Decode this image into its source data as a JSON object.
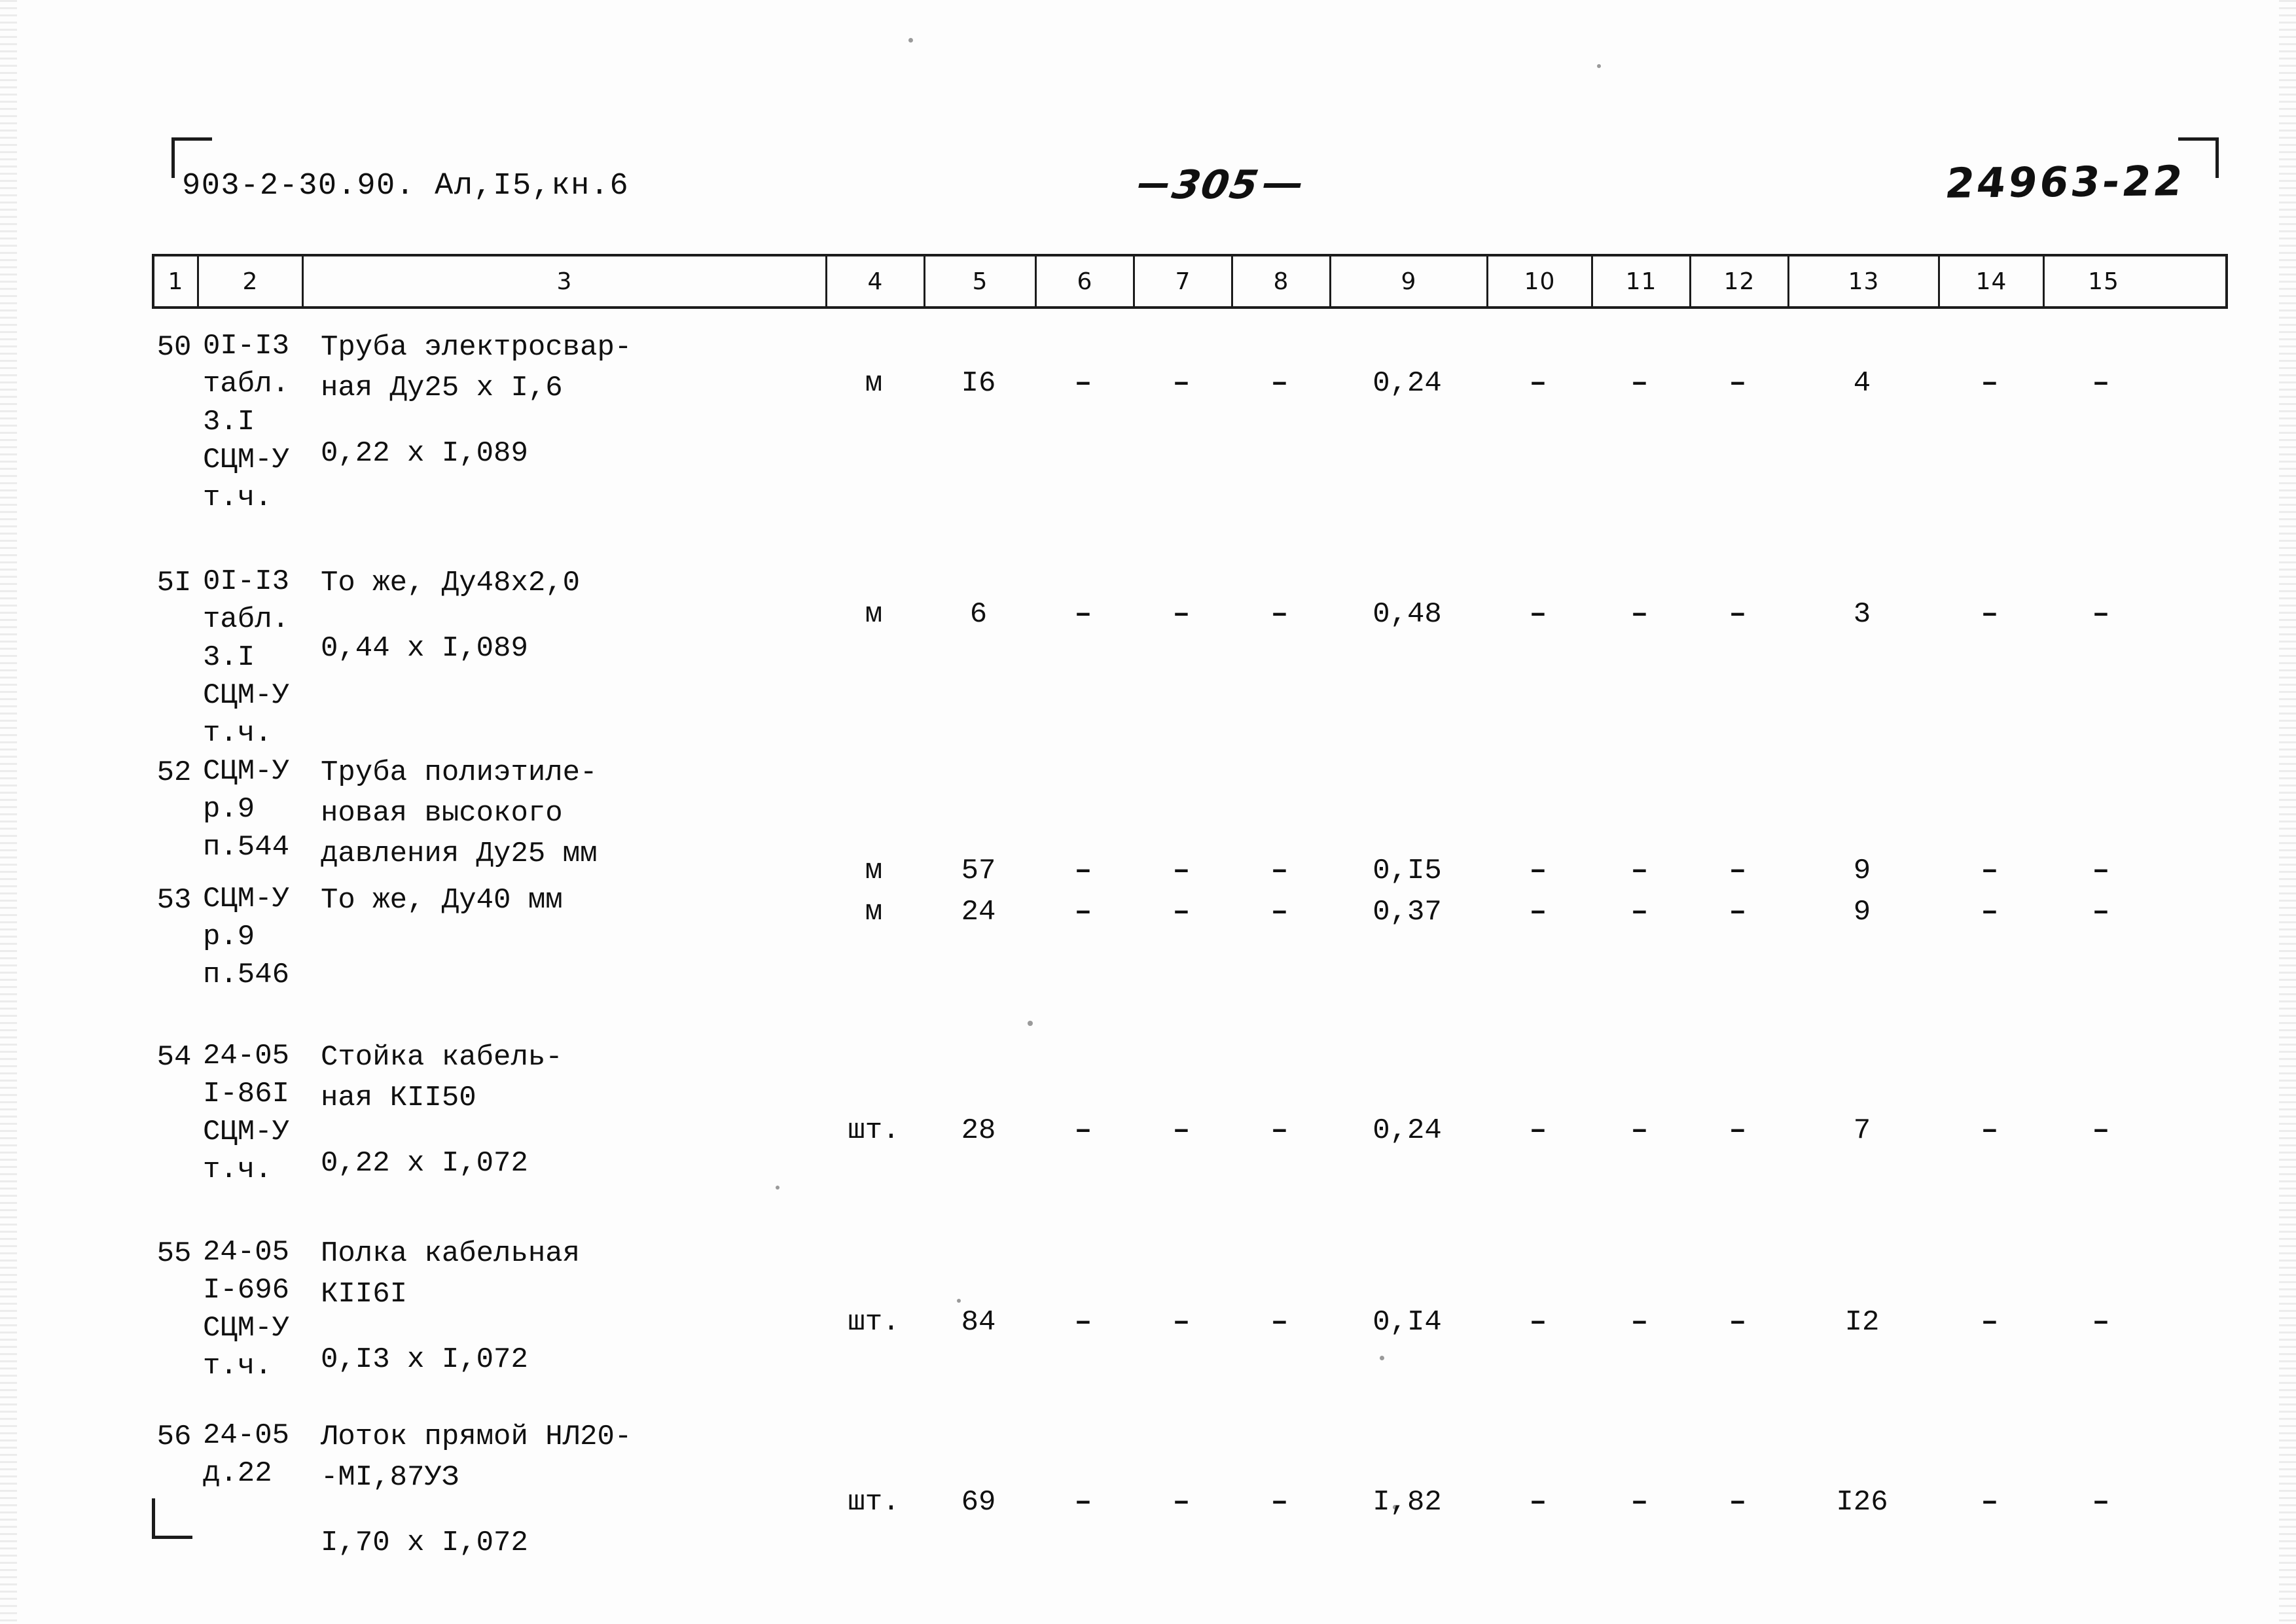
{
  "header": {
    "code": "903-2-30.90. Ал,I5,кн.6",
    "page_number": "305",
    "doc_id": "24963-22"
  },
  "table": {
    "column_headers": [
      "1",
      "2",
      "3",
      "4",
      "5",
      "6",
      "7",
      "8",
      "9",
      "10",
      "11",
      "12",
      "13",
      "14",
      "15"
    ],
    "rows": [
      {
        "no": "50",
        "code_lines": [
          "0I-I3",
          "табл.",
          "3.I",
          "СЦМ-У",
          "т.ч."
        ],
        "desc_lines": [
          "Труба электросвар-",
          "ная Ду25 х I,6"
        ],
        "formula": "0,22 х I,089",
        "unit": "м",
        "c5": "I6",
        "c6": "–",
        "c7": "–",
        "c8": "–",
        "c9": "0,24",
        "c10": "–",
        "c11": "–",
        "c12": "–",
        "c13": "4",
        "c14": "–",
        "c15": "–"
      },
      {
        "no": "5I",
        "code_lines": [
          "0I-I3",
          "табл.",
          "3.I",
          "СЦМ-У",
          "т.ч."
        ],
        "desc_lines": [
          "То же, Ду48х2,0"
        ],
        "formula": "0,44 х I,089",
        "unit": "м",
        "c5": "6",
        "c6": "–",
        "c7": "–",
        "c8": "–",
        "c9": "0,48",
        "c10": "–",
        "c11": "–",
        "c12": "–",
        "c13": "3",
        "c14": "–",
        "c15": "–"
      },
      {
        "no": "52",
        "code_lines": [
          "СЦМ-У",
          "р.9",
          "п.544"
        ],
        "desc_lines": [
          "Труба полиэтиле-",
          "новая высокого",
          "давления Ду25 мм"
        ],
        "formula": "",
        "unit": "м",
        "c5": "57",
        "c6": "–",
        "c7": "–",
        "c8": "–",
        "c9": "0,I5",
        "c10": "–",
        "c11": "–",
        "c12": "–",
        "c13": "9",
        "c14": "–",
        "c15": "–"
      },
      {
        "no": "53",
        "code_lines": [
          "СЦМ-У",
          "р.9",
          "п.546"
        ],
        "desc_lines": [
          "То же, Ду40 мм"
        ],
        "formula": "",
        "unit": "м",
        "c5": "24",
        "c6": "–",
        "c7": "–",
        "c8": "–",
        "c9": "0,37",
        "c10": "–",
        "c11": "–",
        "c12": "–",
        "c13": "9",
        "c14": "–",
        "c15": "–"
      },
      {
        "no": "54",
        "code_lines": [
          "24-05",
          "I-86I",
          "СЦМ-У",
          "т.ч."
        ],
        "desc_lines": [
          "Стойка кабель-",
          "ная КII50"
        ],
        "formula": "0,22 х I,072",
        "unit": "шт.",
        "c5": "28",
        "c6": "–",
        "c7": "–",
        "c8": "–",
        "c9": "0,24",
        "c10": "–",
        "c11": "–",
        "c12": "–",
        "c13": "7",
        "c14": "–",
        "c15": "–"
      },
      {
        "no": "55",
        "code_lines": [
          "24-05",
          "I-696",
          "СЦМ-У",
          "т.ч."
        ],
        "desc_lines": [
          "Полка кабельная",
          "КII6I"
        ],
        "formula": "0,I3 х I,072",
        "unit": "шт.",
        "c5": "84",
        "c6": "–",
        "c7": "–",
        "c8": "–",
        "c9": "0,I4",
        "c10": "–",
        "c11": "–",
        "c12": "–",
        "c13": "I2",
        "c14": "–",
        "c15": "–"
      },
      {
        "no": "56",
        "code_lines": [
          "24-05",
          "д.22"
        ],
        "desc_lines": [
          "Лоток прямой НЛ20-",
          "-МI,87УЗ"
        ],
        "formula": "I,70 х I,072",
        "unit": "шт.",
        "c5": "69",
        "c6": "–",
        "c7": "–",
        "c8": "–",
        "c9": "I,82",
        "c10": "–",
        "c11": "–",
        "c12": "–",
        "c13": "I26",
        "c14": "–",
        "c15": "–"
      }
    ]
  }
}
